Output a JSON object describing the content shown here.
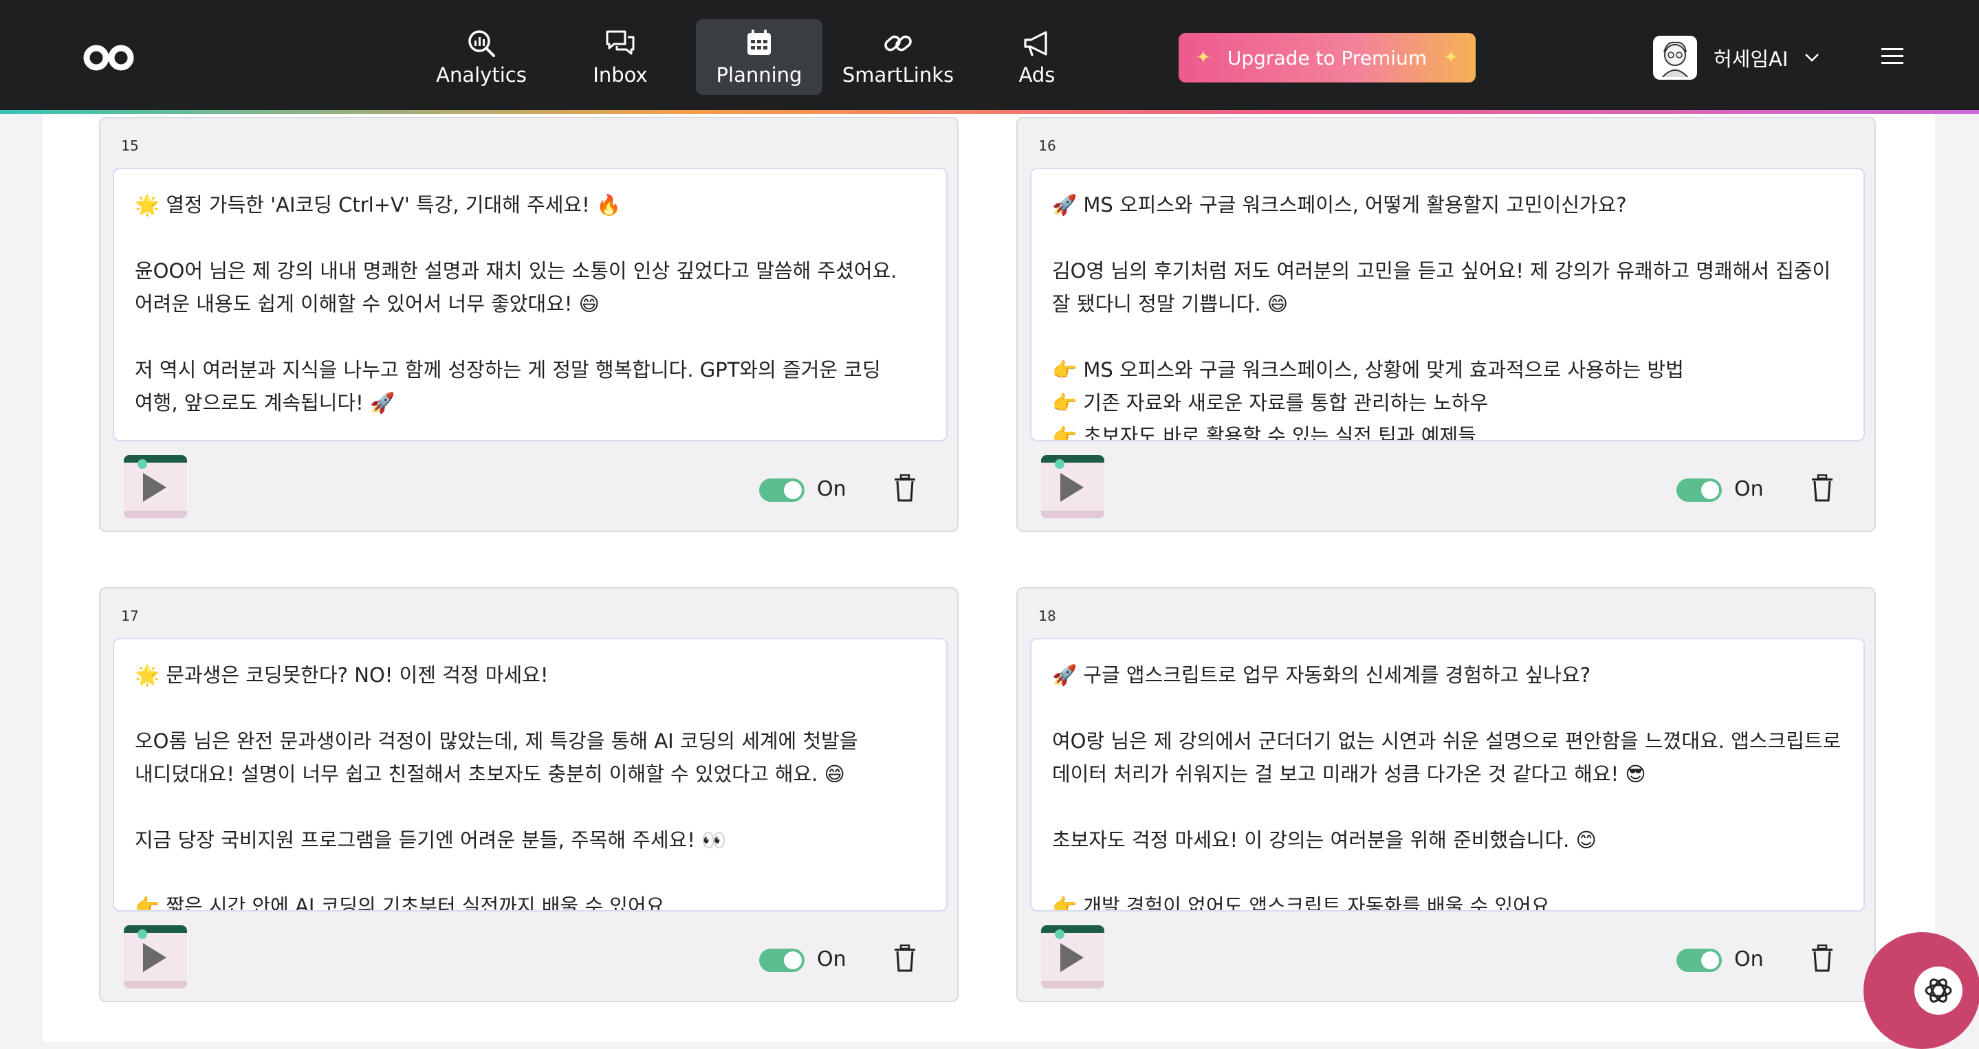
{
  "nav": {
    "items": [
      {
        "label": "Analytics",
        "icon": "analytics-search-icon"
      },
      {
        "label": "Inbox",
        "icon": "chat-bubbles-icon"
      },
      {
        "label": "Planning",
        "icon": "calendar-icon",
        "active": true
      },
      {
        "label": "SmartLinks",
        "icon": "link-icon"
      },
      {
        "label": "Ads",
        "icon": "megaphone-icon"
      }
    ],
    "premium_label": "Upgrade to Premium",
    "user_name": "허세임AI"
  },
  "cards": [
    {
      "number": "15",
      "text": "🌟 열정 가득한 'AI코딩 Ctrl+V' 특강, 기대해 주세요! 🔥\n\n윤OO어 님은 제 강의 내내 명쾌한 설명과 재치 있는 소통이 인상 깊었다고 말씀해 주셨어요. 어려운 내용도 쉽게 이해할 수 있어서 너무 좋았대요! 😄\n\n저 역시 여러분과 지식을 나누고 함께 성장하는 게 정말 행복합니다. GPT와의 즐거운 코딩 여행, 앞으로도 계속됩니다! 🚀",
      "toggle_label": "On"
    },
    {
      "number": "16",
      "text": "🚀 MS 오피스와 구글 워크스페이스, 어떻게 활용할지 고민이신가요?\n\n김O영 님의 후기처럼 저도 여러분의 고민을 듣고 싶어요! 제 강의가 유쾌하고 명쾌해서 집중이 잘 됐다니 정말 기쁩니다. 😄\n\n👉 MS 오피스와 구글 워크스페이스, 상황에 맞게 효과적으로 사용하는 방법\n👉 기존 자료와 새로운 자료를 통합 관리하는 노하우\n👉 초보자도 바로 활용할 수 있는 실전 팁과 예제들",
      "toggle_label": "On"
    },
    {
      "number": "17",
      "text": "🌟 문과생은 코딩못한다? NO! 이젠 걱정 마세요!\n\n오O롬 님은 완전 문과생이라 걱정이 많았는데, 제 특강을 통해 AI 코딩의 세계에 첫발을 내디뎠대요! 설명이 너무 쉽고 친절해서 초보자도 충분히 이해할 수 있었다고 해요. 😄\n\n지금 당장 국비지원 프로그램을 듣기엔 어려운 분들, 주목해 주세요! 👀\n\n👉 짧은 시간 안에 AI 코딩의 기초부터 실전까지 배울 수 있어요",
      "toggle_label": "On"
    },
    {
      "number": "18",
      "text": "🚀 구글 앱스크립트로 업무 자동화의 신세계를 경험하고 싶나요?\n\n여O랑 님은 제 강의에서 군더더기 없는 시연과 쉬운 설명으로 편안함을 느꼈대요. 앱스크립트로 데이터 처리가 쉬워지는 걸 보고 미래가 성큼 다가온 것 같다고 해요! 😎\n\n초보자도 걱정 마세요! 이 강의는 여러분을 위해 준비했습니다. 😊\n\n👉 개발 경험이 없어도 앱스크립트 자동화를 배울 수 있어요",
      "toggle_label": "On"
    }
  ],
  "colors": {
    "topbar": "#1d1f21",
    "toggle_on": "#5cbe8f",
    "premium_start": "#ee5a8e",
    "premium_end": "#f5b255",
    "chat_fab": "#c8446b"
  }
}
